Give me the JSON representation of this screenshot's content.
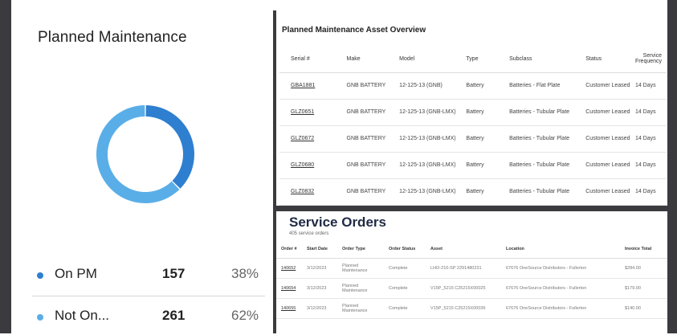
{
  "planned_maintenance": {
    "title": "Planned Maintenance",
    "chart_data": {
      "type": "pie",
      "categories": [
        "On PM",
        "Not On..."
      ],
      "values": [
        157,
        261
      ],
      "colors": [
        "#2f7fd0",
        "#5aaee8"
      ]
    },
    "legend": [
      {
        "label": "On PM",
        "count": "157",
        "pct": "38%",
        "color": "#2f7fd0"
      },
      {
        "label": "Not On...",
        "count": "261",
        "pct": "62%",
        "color": "#5aaee8"
      }
    ]
  },
  "asset_overview": {
    "title": "Planned Maintenance Asset Overview",
    "columns": [
      "Serial #",
      "Make",
      "Model",
      "Type",
      "Subclass",
      "Status",
      "Service Frequency"
    ],
    "rows": [
      [
        "GBA1881",
        "GNB BATTERY",
        "12-125-13 (GNB)",
        "Battery",
        "Batteries - Flat Plate",
        "Customer Leased",
        "14 Days"
      ],
      [
        "GLZ0651",
        "GNB BATTERY",
        "12-125-13 (GNB-LMX)",
        "Battery",
        "Batteries - Tubular Plate",
        "Customer Leased",
        "14 Days"
      ],
      [
        "GLZ0672",
        "GNB BATTERY",
        "12-125-13 (GNB-LMX)",
        "Battery",
        "Batteries - Tubular Plate",
        "Customer Leased",
        "14 Days"
      ],
      [
        "GLZ0680",
        "GNB BATTERY",
        "12-125-13 (GNB-LMX)",
        "Battery",
        "Batteries - Tubular Plate",
        "Customer Leased",
        "14 Days"
      ],
      [
        "GLZ0832",
        "GNB BATTERY",
        "12-125-13 (GNB-LMX)",
        "Battery",
        "Batteries - Tubular Plate",
        "Customer Leased",
        "14 Days"
      ]
    ]
  },
  "service_orders": {
    "title": "Service Orders",
    "subtitle": "405 service orders",
    "columns": [
      "Order #",
      "Start Date",
      "Order Type",
      "Order Status",
      "Asset",
      "Location",
      "Invoice Total"
    ],
    "rows": [
      [
        "140652",
        "3/12/2023",
        "Planned Maintenance",
        "Complete",
        "LHO-210-SP 2291480231",
        "67676 OneSource Distributors - Fullerton",
        "$284.00"
      ],
      [
        "140654",
        "3/12/2023",
        "Planned Maintenance",
        "Complete",
        "V15P_5215 C25215X00025",
        "67676 OneSource Distributors - Fullerton",
        "$179.00"
      ],
      [
        "140655",
        "3/12/2023",
        "Planned Maintenance",
        "Complete",
        "V15P_5215 C25215X00036",
        "67676 OneSource Distributors - Fullerton",
        "$140.00"
      ]
    ]
  }
}
